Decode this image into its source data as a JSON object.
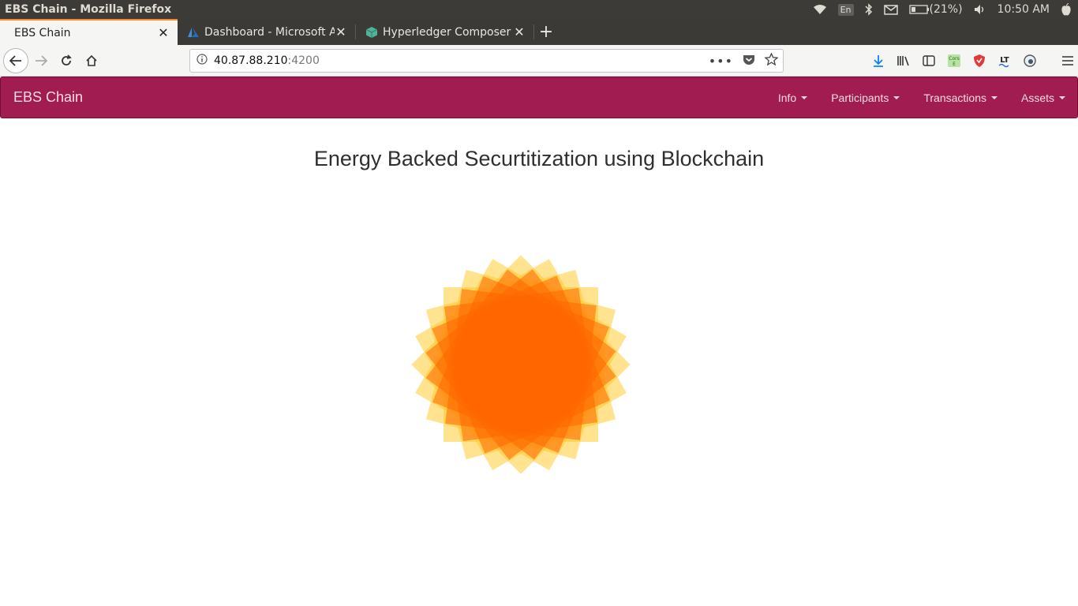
{
  "os_bar": {
    "window_title": "EBS Chain - Mozilla Firefox",
    "keyboard_lang": "En",
    "battery": "(21%)",
    "time": "10:50 AM",
    "icons": [
      "wifi-icon",
      "bluetooth-icon",
      "mail-icon",
      "battery-icon",
      "volume-icon",
      "apple-icon"
    ]
  },
  "tabs": [
    {
      "label": "EBS Chain",
      "active": true
    },
    {
      "label": "Dashboard - Microsoft A",
      "icon": "azure-icon"
    },
    {
      "label": "Hyperledger Composer",
      "icon": "cube-icon"
    }
  ],
  "new_tab_label": "+",
  "address": {
    "host": "40.87.88.210",
    "port": ":4200"
  },
  "app": {
    "brand": "EBS Chain",
    "menu": [
      {
        "label": "Info"
      },
      {
        "label": "Participants"
      },
      {
        "label": "Transactions"
      },
      {
        "label": "Assets"
      }
    ]
  },
  "main": {
    "title": "Energy Backed Securtitization using Blockchain",
    "graphic": "sun-logo"
  },
  "colors": {
    "brand_bar": "#a11d51",
    "sun_core": "#ff6600",
    "sun_petals": "#ffcc33"
  }
}
